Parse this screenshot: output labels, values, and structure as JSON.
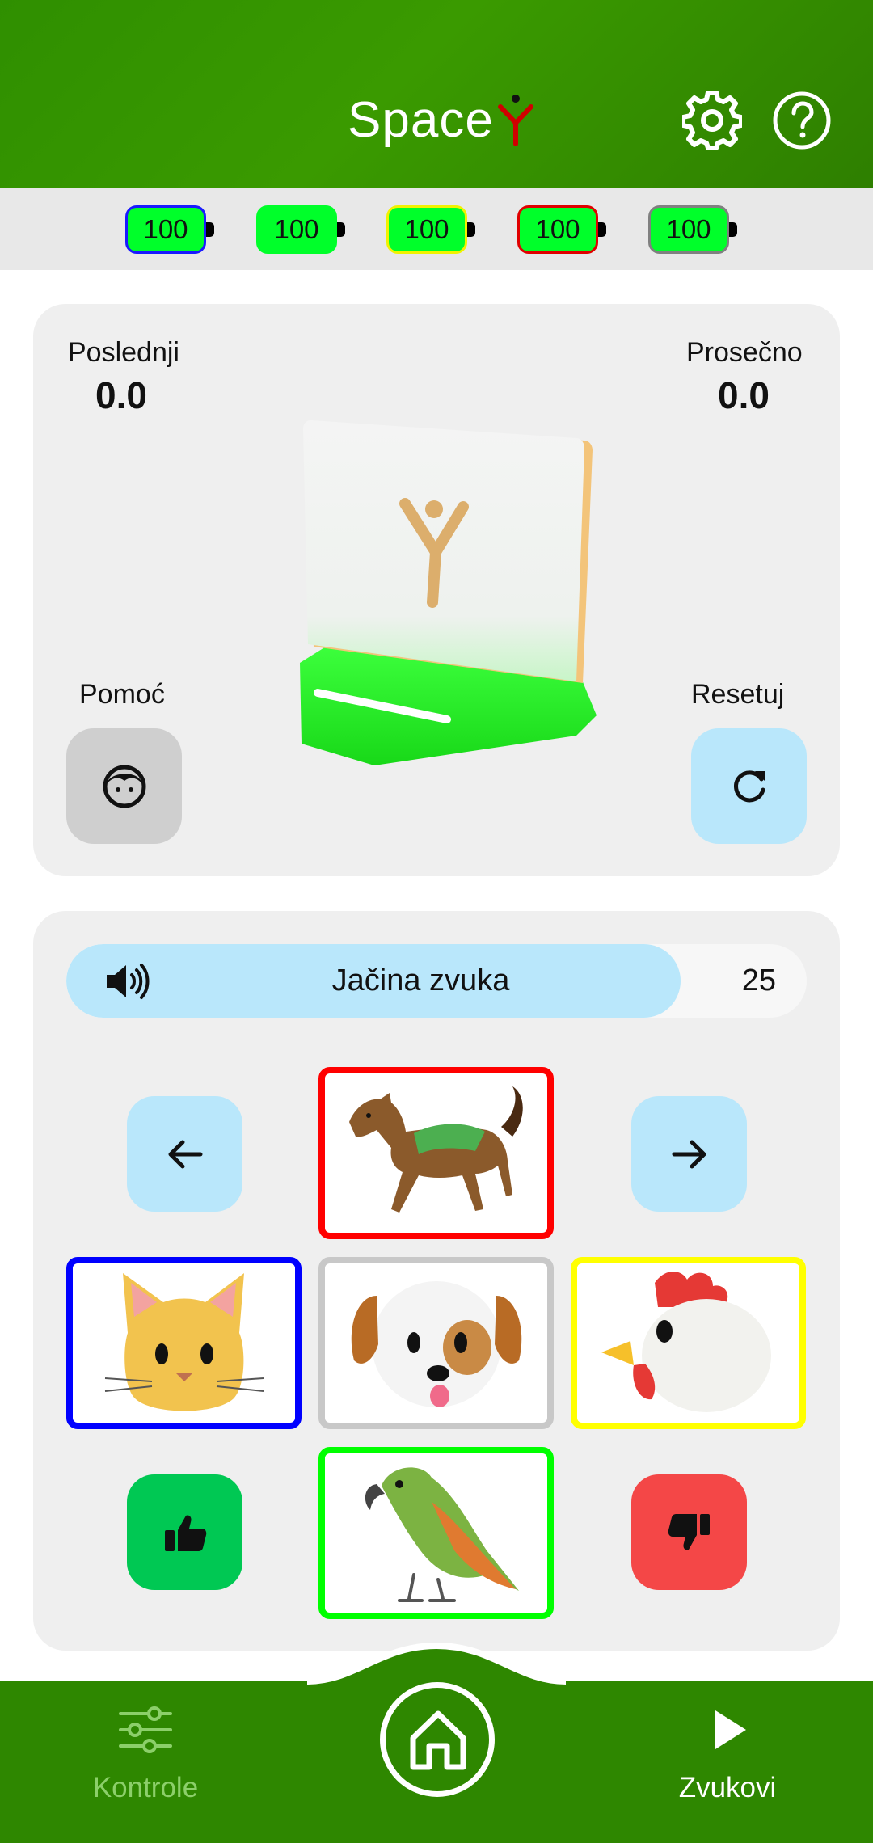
{
  "header": {
    "brand_text": "Space",
    "brand_mark": "Y",
    "settings_icon": "gear-icon",
    "help_icon": "question-circle-icon"
  },
  "batteries": [
    {
      "value": "100",
      "border_color": "#1a1aff"
    },
    {
      "value": "100",
      "border_color": "#00ff2a"
    },
    {
      "value": "100",
      "border_color": "#f2f200"
    },
    {
      "value": "100",
      "border_color": "#e00000"
    },
    {
      "value": "100",
      "border_color": "#808080"
    }
  ],
  "stats": {
    "last_label": "Poslednji",
    "last_value": "0.0",
    "avg_label": "Prosečno",
    "avg_value": "0.0"
  },
  "actions": {
    "help_label": "Pomoć",
    "help_icon": "face-icon",
    "reset_label": "Resetuj",
    "reset_icon": "refresh-icon"
  },
  "volume": {
    "label": "Jačina zvuka",
    "value": "25",
    "level": 0.83,
    "icon": "speaker-icon"
  },
  "sounds": {
    "prev_icon": "arrow-left-icon",
    "next_icon": "arrow-right-icon",
    "like_icon": "thumbs-up-icon",
    "dislike_icon": "thumbs-down-icon",
    "tiles": [
      {
        "animal": "horse",
        "border_color": "#ff0000"
      },
      {
        "animal": "cat",
        "border_color": "#0000ff"
      },
      {
        "animal": "dog",
        "border_color": "#c8c8c8"
      },
      {
        "animal": "rooster",
        "border_color": "#ffff00"
      },
      {
        "animal": "parrot",
        "border_color": "#00ff00"
      }
    ]
  },
  "nav": {
    "controls_label": "Kontrole",
    "controls_icon": "sliders-icon",
    "home_icon": "home-icon",
    "sounds_label": "Zvukovi",
    "sounds_icon": "play-icon"
  },
  "colors": {
    "header_green": "#2f8f00",
    "battery_green": "#00ff2a",
    "light_blue": "#b9e7fb",
    "like_green": "#00c853",
    "dislike_red": "#f44747"
  }
}
